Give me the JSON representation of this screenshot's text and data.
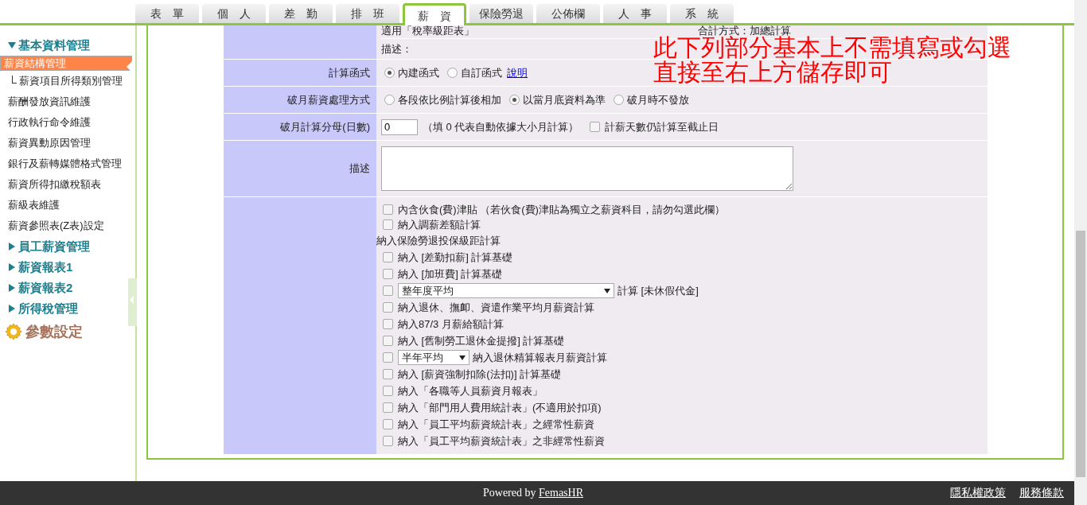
{
  "tabs": [
    {
      "label": "表　單",
      "selected": false
    },
    {
      "label": "個　人",
      "selected": false
    },
    {
      "label": "差　勤",
      "selected": false
    },
    {
      "label": "排　班",
      "selected": false
    },
    {
      "label": "薪　資",
      "selected": true
    },
    {
      "label": "保險勞退",
      "selected": false
    },
    {
      "label": "公佈欄",
      "selected": false
    },
    {
      "label": "人　事",
      "selected": false
    },
    {
      "label": "系　統",
      "selected": false
    }
  ],
  "sidebar": {
    "groups": [
      {
        "kind": "group",
        "label": "基本資料管理",
        "expanded": true,
        "items": [
          {
            "label": "薪資結構管理",
            "selected": true,
            "children": [
              {
                "label": "薪資項目所得類別管理",
                "selected": false
              }
            ]
          },
          {
            "label": "薪酬發放資訊維護",
            "selected": false
          },
          {
            "label": "行政執行命令維護",
            "selected": false
          },
          {
            "label": "薪資異動原因管理",
            "selected": false
          },
          {
            "label": "銀行及薪轉媒體格式管理",
            "selected": false
          },
          {
            "label": "薪資所得扣繳稅額表",
            "selected": false
          },
          {
            "label": "薪級表維護",
            "selected": false
          },
          {
            "label": "薪資參照表(Z表)設定",
            "selected": false
          }
        ]
      },
      {
        "kind": "group",
        "label": "員工薪資管理",
        "expanded": false
      },
      {
        "kind": "group",
        "label": "薪資報表1",
        "expanded": false
      },
      {
        "kind": "group",
        "label": "薪資報表2",
        "expanded": false
      },
      {
        "kind": "group",
        "label": "所得稅管理",
        "expanded": false
      },
      {
        "kind": "settings",
        "label": "參數設定"
      }
    ]
  },
  "form": {
    "top": {
      "left": "適用「稅率級距表」",
      "right": "合計方式：加總計算",
      "description": "描述："
    },
    "note": [
      "此下列部分基本上不需填寫或勾選",
      "直接至右上方儲存即可"
    ],
    "calc_function": {
      "label": "計算函式",
      "options": [
        {
          "label": "內建函式",
          "selected": true
        },
        {
          "label": "自訂函式",
          "selected": false
        }
      ],
      "link": "說明"
    },
    "partial_month": {
      "label": "破月薪資處理方式",
      "options": [
        {
          "label": "各段依比例計算後相加",
          "selected": false
        },
        {
          "label": "以當月底資料為準",
          "selected": true
        },
        {
          "label": "破月時不發放",
          "selected": false
        }
      ]
    },
    "denominator": {
      "label": "破月計算分母(日數)",
      "value": "0",
      "hint": "（填 0 代表自動依據大小月計算）",
      "checkbox": {
        "label": "計薪天數仍計算至截止日",
        "checked": false
      }
    },
    "description": {
      "label": "描述"
    },
    "options": [
      {
        "kind": "checkbox",
        "checked": false,
        "text": "內含伙食(費)津貼 （若伙食(費)津貼為獨立之薪資科目，請勿勾選此欄）"
      },
      {
        "kind": "checkbox",
        "checked": false,
        "text": "納入調薪差額計算"
      },
      {
        "kind": "heading",
        "text": "納入保險勞退投保級距計算"
      },
      {
        "kind": "checkbox",
        "checked": false,
        "text": "納入 [差勤扣薪] 計算基礎"
      },
      {
        "kind": "checkbox",
        "checked": false,
        "text": "納入 [加班費] 計算基礎"
      },
      {
        "kind": "long-select",
        "checked": false,
        "select": "整年度平均",
        "text": "計算 [未休假代金]"
      },
      {
        "kind": "checkbox",
        "checked": false,
        "text": "納入退休、撫卹、資遣作業平均月薪資計算"
      },
      {
        "kind": "checkbox",
        "checked": false,
        "text": "納入87/3 月薪給額計算"
      },
      {
        "kind": "checkbox",
        "checked": false,
        "text": "納入 [舊制勞工退休金提撥] 計算基礎"
      },
      {
        "kind": "short-select",
        "checked": false,
        "select": "半年平均",
        "text": "納入退休精算報表月薪資計算"
      },
      {
        "kind": "checkbox",
        "checked": false,
        "text": "納入 [薪資強制扣除(法扣)] 計算基礎"
      },
      {
        "kind": "checkbox",
        "checked": false,
        "text": "納入「各職等人員薪資月報表」"
      },
      {
        "kind": "checkbox",
        "checked": false,
        "text": "納入「部門用人費用統計表」(不適用於扣項)"
      },
      {
        "kind": "checkbox",
        "checked": false,
        "text": "納入「員工平均薪資統計表」之經常性薪資"
      },
      {
        "kind": "checkbox",
        "checked": false,
        "text": "納入「員工平均薪資統計表」之非經常性薪資"
      }
    ]
  },
  "footer": {
    "powered_by": "Powered by",
    "brand": "FemasHR",
    "links": [
      "隱私權政策",
      "服務條款"
    ]
  }
}
